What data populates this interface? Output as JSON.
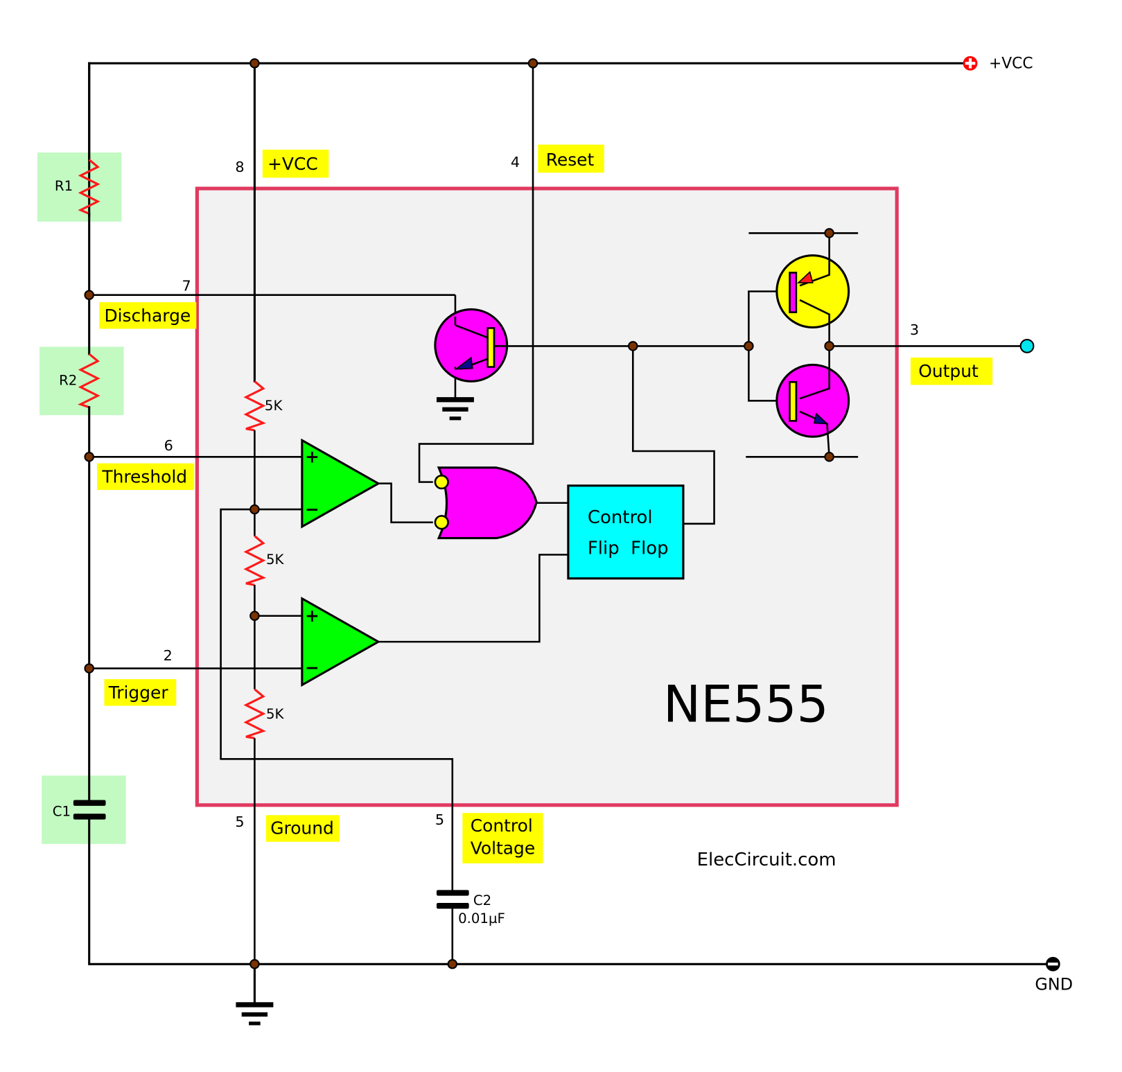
{
  "title": "NE555",
  "watermark": "ElecCircuit.com",
  "colors": {
    "chip_border": "#e03a60",
    "chip_fill": "#f2f2f2",
    "label_highlight": "#ffff00",
    "component_highlight": "#c2fac2",
    "resistor": "#ff1a1a",
    "comparator": "#00ff00",
    "or_gate": "#ff00ff",
    "flip_flop": "#00ffff",
    "transistor_npn": "#ff00ff",
    "transistor_pnp": "#ffff00",
    "junction": "#7a3300",
    "output_terminal": "#00e5ee",
    "vcc_terminal": "#ff0000"
  },
  "rails": {
    "vcc_label": "+VCC",
    "vcc_icon": "plus-circle",
    "gnd_label": "GND",
    "gnd_icon": "minus-circle"
  },
  "external_components": {
    "r1": "R1",
    "r2": "R2",
    "c1": "C1",
    "c2": "C2",
    "c2_value": "0.01µF"
  },
  "internal": {
    "divider_resistors": [
      "5K",
      "5K",
      "5K"
    ],
    "comparator_plus": "+",
    "comparator_minus": "−",
    "flip_flop_line1": "Control",
    "flip_flop_line2": "Flip  Flop"
  },
  "pins": [
    {
      "number": "8",
      "name": "+VCC"
    },
    {
      "number": "4",
      "name": "Reset"
    },
    {
      "number": "7",
      "name": "Discharge"
    },
    {
      "number": "6",
      "name": "Threshold"
    },
    {
      "number": "2",
      "name": "Trigger"
    },
    {
      "number": "3",
      "name": "Output"
    },
    {
      "number": "5",
      "name": "Ground"
    },
    {
      "number": "5",
      "name_line1": "Control",
      "name_line2": "Voltage"
    }
  ]
}
